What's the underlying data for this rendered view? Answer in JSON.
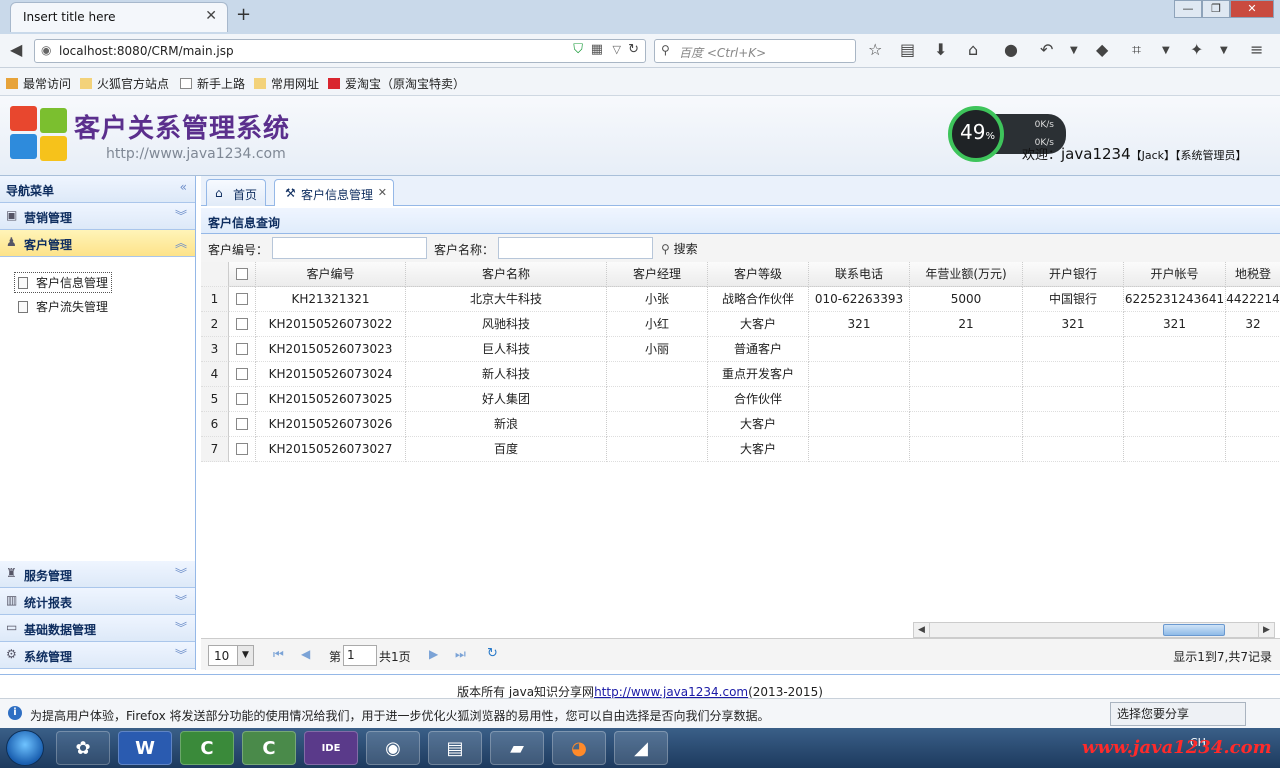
{
  "browser": {
    "tab_title": "Insert title here",
    "tab_close": "✕",
    "new_tab": "+",
    "url": "localhost:8080/CRM/main.jsp",
    "search_placeholder": "百度 <Ctrl+K>",
    "bookmarks": [
      "最常访问",
      "火狐官方站点",
      "新手上路",
      "常用网址",
      "爱淘宝（原淘宝特卖）"
    ]
  },
  "app": {
    "title": "客户关系管理系统",
    "url": "http://www.java1234.com",
    "gauge_value": "49",
    "gauge_unit": "%",
    "rate_up": "0K/s",
    "rate_down": "0K/s",
    "welcome_prefix": "欢迎：",
    "welcome_user": "java1234",
    "welcome_name": "【Jack】",
    "welcome_role": "【系统管理员】"
  },
  "sidebar": {
    "title": "导航菜单",
    "sections": {
      "marketing": "营销管理",
      "customer": "客户管理",
      "service": "服务管理",
      "stats": "统计报表",
      "basedata": "基础数据管理",
      "system": "系统管理"
    },
    "customer_items": [
      "客户信息管理",
      "客户流失管理"
    ]
  },
  "main": {
    "tabs": [
      "首页",
      "客户信息管理"
    ],
    "panel_title": "客户信息查询",
    "search": {
      "code_label": "客户编号：",
      "name_label": "客户名称：",
      "button": "搜索"
    },
    "columns": [
      "客户编号",
      "客户名称",
      "客户经理",
      "客户等级",
      "联系电话",
      "年营业额(万元)",
      "开户银行",
      "开户帐号",
      "地税登"
    ],
    "rows": [
      [
        "KH21321321",
        "北京大牛科技",
        "小张",
        "战略合作伙伴",
        "010-62263393",
        "5000",
        "中国银行",
        "6225231243641",
        "4422214"
      ],
      [
        "KH20150526073022",
        "风驰科技",
        "小红",
        "大客户",
        "321",
        "21",
        "321",
        "321",
        "32"
      ],
      [
        "KH20150526073023",
        "巨人科技",
        "小丽",
        "普通客户",
        "",
        "",
        "",
        "",
        ""
      ],
      [
        "KH20150526073024",
        "新人科技",
        "",
        "重点开发客户",
        "",
        "",
        "",
        "",
        ""
      ],
      [
        "KH20150526073025",
        "好人集团",
        "",
        "合作伙伴",
        "",
        "",
        "",
        "",
        ""
      ],
      [
        "KH20150526073026",
        "新浪",
        "",
        "大客户",
        "",
        "",
        "",
        "",
        ""
      ],
      [
        "KH20150526073027",
        "百度",
        "",
        "大客户",
        "",
        "",
        "",
        "",
        ""
      ]
    ],
    "pager": {
      "page_size": "10",
      "page_prefix": "第",
      "page_value": "1",
      "page_suffix": "共1页",
      "info": "显示1到7,共7记录"
    }
  },
  "footer": {
    "text": "版本所有 java知识分享网 ",
    "link": "http://www.java1234.com",
    "years": "(2013-2015)"
  },
  "notification": {
    "text": "为提高用户体验，Firefox 将发送部分功能的使用情况给我们，用于进一步优化火狐浏览器的易用性，您可以自由选择是否向我们分享数据。",
    "button": "选择您要分享"
  },
  "taskbar": {
    "tray": "CH",
    "watermark": "www.java1234.com"
  }
}
